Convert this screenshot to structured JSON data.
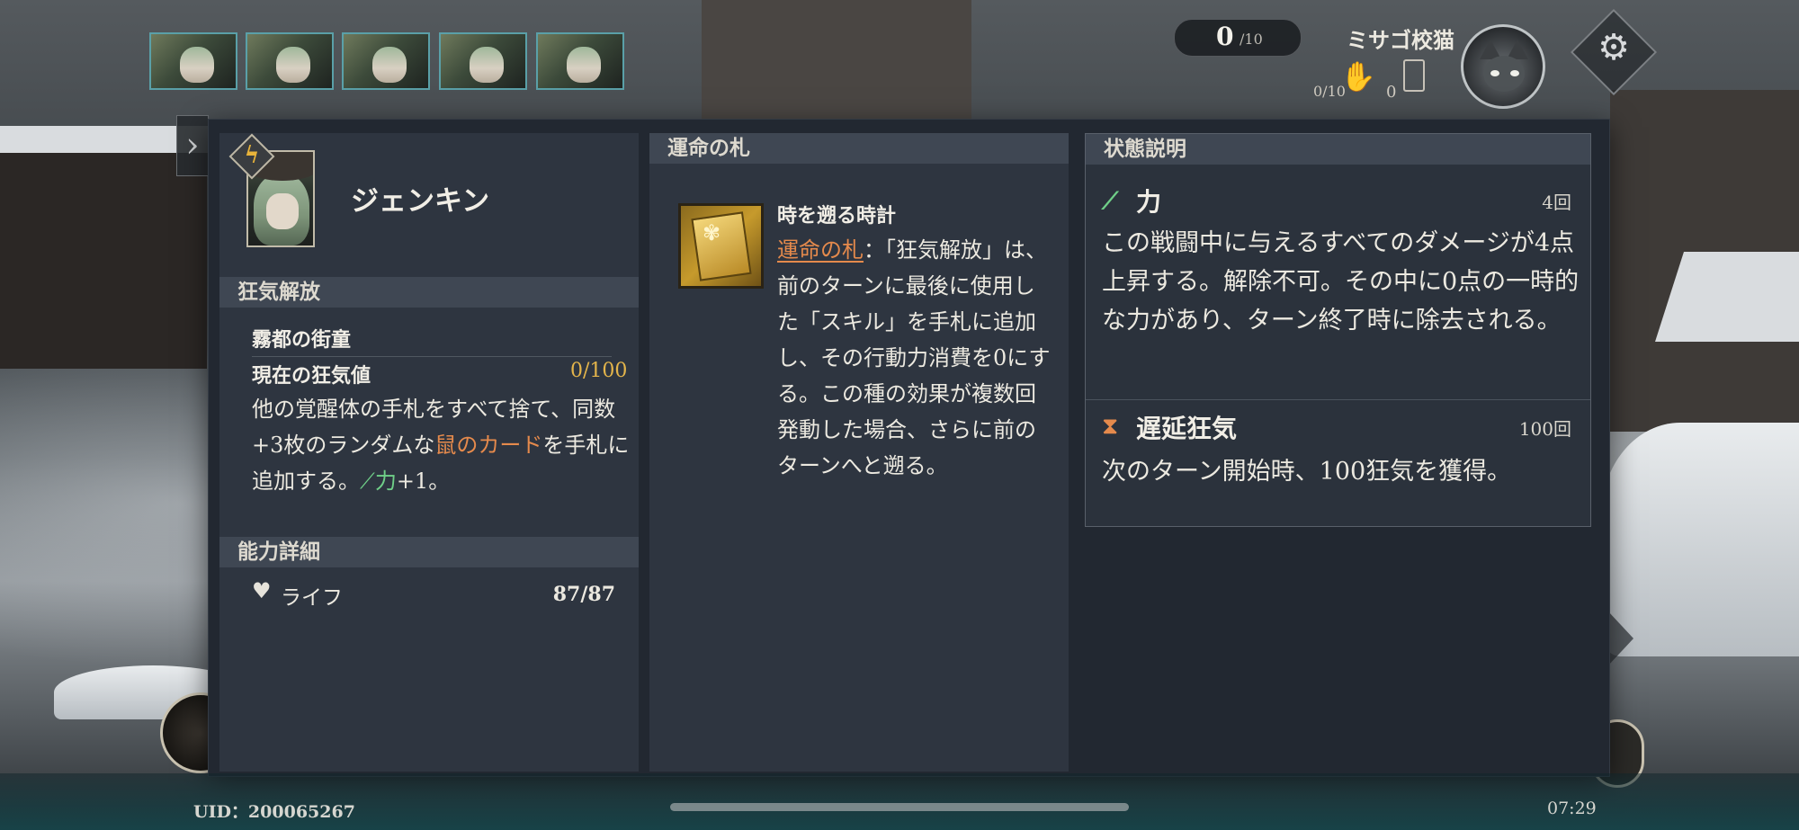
{
  "hud": {
    "counter_value": "0",
    "counter_max": "/10",
    "player_name": "ミサゴ校猫",
    "stat_hand": "0/10",
    "stat_deck": "0",
    "settings_icon": "gear-icon",
    "team_portraits": [
      "portrait",
      "portrait",
      "portrait",
      "portrait",
      "portrait"
    ]
  },
  "character": {
    "name": "ジェンキン",
    "badge_icon": "lightning-bolt-icon"
  },
  "madness": {
    "header": "狂気解放",
    "subtitle": "霧都の街童",
    "label": "現在の狂気値",
    "value": "0/100",
    "desc_part1": "他の覚醒体の手札をすべて捨て、同数+3枚のランダムな",
    "desc_highlight": "鼠のカード",
    "desc_part2": "を手札に追加する。",
    "desc_buff": "力",
    "desc_part3": "+1。"
  },
  "ability": {
    "header": "能力詳細",
    "life_label": "ライフ",
    "life_value": "87/87"
  },
  "fate": {
    "header": "運命の札",
    "card_title": "時を遡る時計",
    "card_link": "運命の札",
    "card_desc": "：「狂気解放」は、前のターンに最後に使用した「スキル」を手札に追加し、その行動力消費を0にする。この種の効果が複数回発動した場合、さらに前のターンへと遡る。"
  },
  "status": {
    "header": "状態説明",
    "items": [
      {
        "name": "力",
        "count": "4回",
        "desc": "この戦闘中に与えるすべてのダメージが4点上昇する。解除不可。その中に0点の一時的な力があり、ターン終了時に除去される。",
        "icon": "sword-icon",
        "color": "#6fcf88"
      },
      {
        "name": "遅延狂気",
        "count": "100回",
        "desc": "次のターン開始時、100狂気を獲得。",
        "icon": "hourglass-icon",
        "color": "#e58a4c"
      }
    ]
  },
  "footer": {
    "uid": "UID：200065267",
    "time": "07:29"
  },
  "colors": {
    "accent_orange": "#e58a4c",
    "accent_gold": "#e4b54b",
    "accent_green": "#6fcf88",
    "panel_bg": "#222831"
  }
}
